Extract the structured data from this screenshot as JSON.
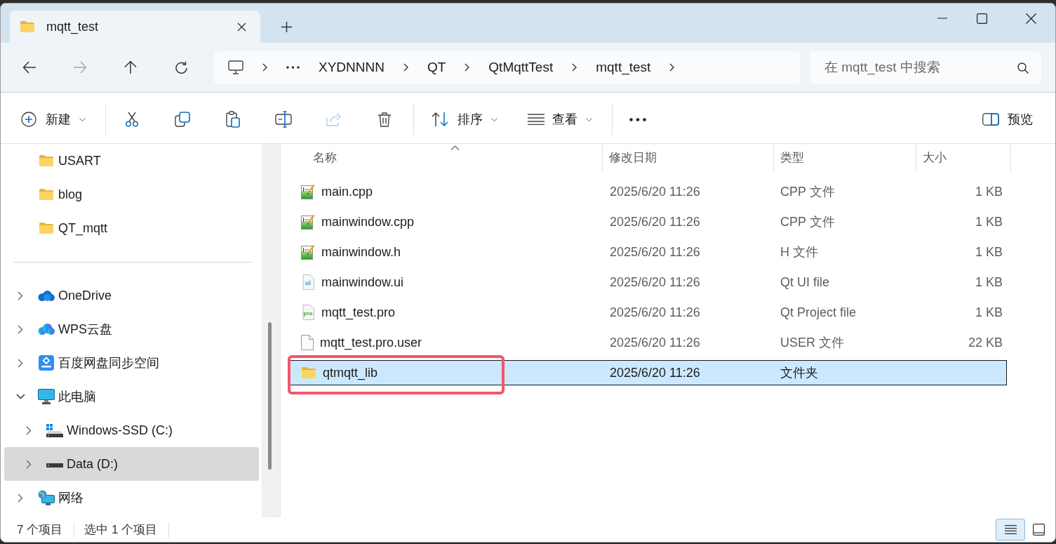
{
  "tabs": [
    {
      "title": "mqtt_test",
      "selected": true
    }
  ],
  "nav_buttons": [
    {
      "kind": "back",
      "disabled": false
    },
    {
      "kind": "forward",
      "disabled": true
    },
    {
      "kind": "up",
      "disabled": false
    },
    {
      "kind": "refresh",
      "disabled": false
    }
  ],
  "address_bar": {
    "segments": [
      "XYDNNNN",
      "QT",
      "QtMqttTest",
      "mqtt_test"
    ]
  },
  "search": {
    "placeholder": "在 mqtt_test 中搜索"
  },
  "toolbar": {
    "new": {
      "label": "新建"
    },
    "actions": [
      {
        "kind": "cut",
        "disabled": false
      },
      {
        "kind": "copy",
        "disabled": false
      },
      {
        "kind": "paste",
        "disabled": false
      },
      {
        "kind": "rename",
        "disabled": false
      },
      {
        "kind": "share",
        "disabled": true
      },
      {
        "kind": "delete",
        "disabled": false
      }
    ],
    "sort": {
      "label": "排序"
    },
    "view": {
      "label": "查看"
    },
    "preview": {
      "label": "预览"
    }
  },
  "sidebar": {
    "pinned": [
      {
        "label": "USART",
        "selected": false
      },
      {
        "label": "blog",
        "selected": false
      },
      {
        "label": "QT_mqtt",
        "selected": false
      }
    ],
    "tree": [
      {
        "label": "OneDrive",
        "kind": "cloud",
        "expanded": false,
        "selected": false
      },
      {
        "label": "WPS云盘",
        "kind": "colorcloud",
        "expanded": false,
        "selected": false
      },
      {
        "label": "百度网盘同步空间",
        "kind": "synctile",
        "expanded": false,
        "selected": false
      },
      {
        "label": "此电脑",
        "kind": "computer",
        "expanded": true,
        "selected": false,
        "children": [
          {
            "label": "Windows-SSD (C:)",
            "kind": "systemdisk",
            "expanded": false,
            "selected": false
          },
          {
            "label": "Data (D:)",
            "kind": "disk",
            "expanded": false,
            "selected": true
          }
        ]
      },
      {
        "label": "网络",
        "kind": "network",
        "expanded": false,
        "selected": false
      }
    ]
  },
  "columns": [
    {
      "label": "名称",
      "sorted": true
    },
    {
      "label": "修改日期",
      "sorted": false
    },
    {
      "label": "类型",
      "sorted": false
    },
    {
      "label": "大小",
      "sorted": false
    }
  ],
  "files": [
    {
      "name": "main.cpp",
      "kind": "source",
      "modified": "2025/6/20 11:26",
      "type": "CPP 文件",
      "size": "1 KB",
      "selected": false,
      "highlighted": false
    },
    {
      "name": "mainwindow.cpp",
      "kind": "source",
      "modified": "2025/6/20 11:26",
      "type": "CPP 文件",
      "size": "1 KB",
      "selected": false,
      "highlighted": false
    },
    {
      "name": "mainwindow.h",
      "kind": "source",
      "modified": "2025/6/20 11:26",
      "type": "H 文件",
      "size": "1 KB",
      "selected": false,
      "highlighted": false
    },
    {
      "name": "mainwindow.ui",
      "kind": "ui",
      "icon_text": "ui",
      "modified": "2025/6/20 11:26",
      "type": "Qt UI file",
      "size": "1 KB",
      "selected": false,
      "highlighted": false
    },
    {
      "name": "mqtt_test.pro",
      "kind": "project",
      "icon_text": "pro",
      "modified": "2025/6/20 11:26",
      "type": "Qt Project file",
      "size": "1 KB",
      "selected": false,
      "highlighted": false
    },
    {
      "name": "mqtt_test.pro.user",
      "kind": "plain",
      "modified": "2025/6/20 11:26",
      "type": "USER 文件",
      "size": "22 KB",
      "selected": false,
      "highlighted": false
    },
    {
      "name": "qtmqtt_lib",
      "kind": "folder",
      "modified": "2025/6/20 11:26",
      "type": "文件夹",
      "selected": true,
      "highlighted": true
    }
  ],
  "status_bar": {
    "item_count": "7 个项目",
    "selection": "选中 1 个项目",
    "views": [
      {
        "kind": "details",
        "selected": true
      },
      {
        "kind": "tiles",
        "selected": false
      }
    ]
  }
}
